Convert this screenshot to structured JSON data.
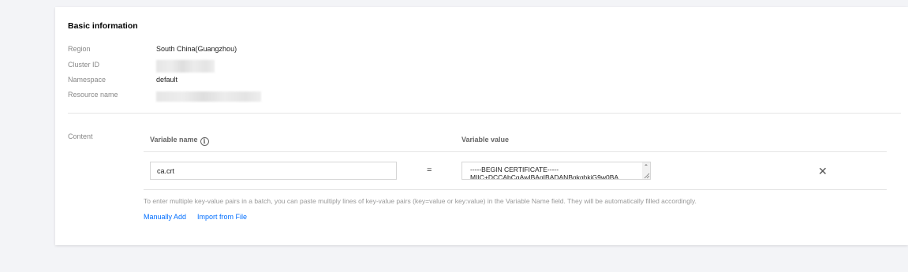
{
  "basic": {
    "title": "Basic information",
    "region_label": "Region",
    "region_value": "South China(Guangzhou)",
    "cluster_label": "Cluster ID",
    "namespace_label": "Namespace",
    "namespace_value": "default",
    "resource_label": "Resource name"
  },
  "content": {
    "label": "Content",
    "col_name": "Variable name",
    "col_value": "Variable value",
    "rows": [
      {
        "name": "ca.crt",
        "equals": "=",
        "value": "-----BEGIN CERTIFICATE-----\nMIIC+DCCAbCgAwIBAgIBADANBgkqhkiG9w0BA"
      }
    ],
    "hint": "To enter multiple key-value pairs in a batch, you can paste multiply lines of key-value pairs (key=value or key:value) in the Variable Name field. They will be automatically filled accordingly.",
    "manual_add": "Manually Add",
    "import_file": "Import from File"
  },
  "icons": {
    "info": "info-circle-icon",
    "delete": "close-icon"
  },
  "colors": {
    "link": "#006eff",
    "background": "#f3f4f7"
  }
}
